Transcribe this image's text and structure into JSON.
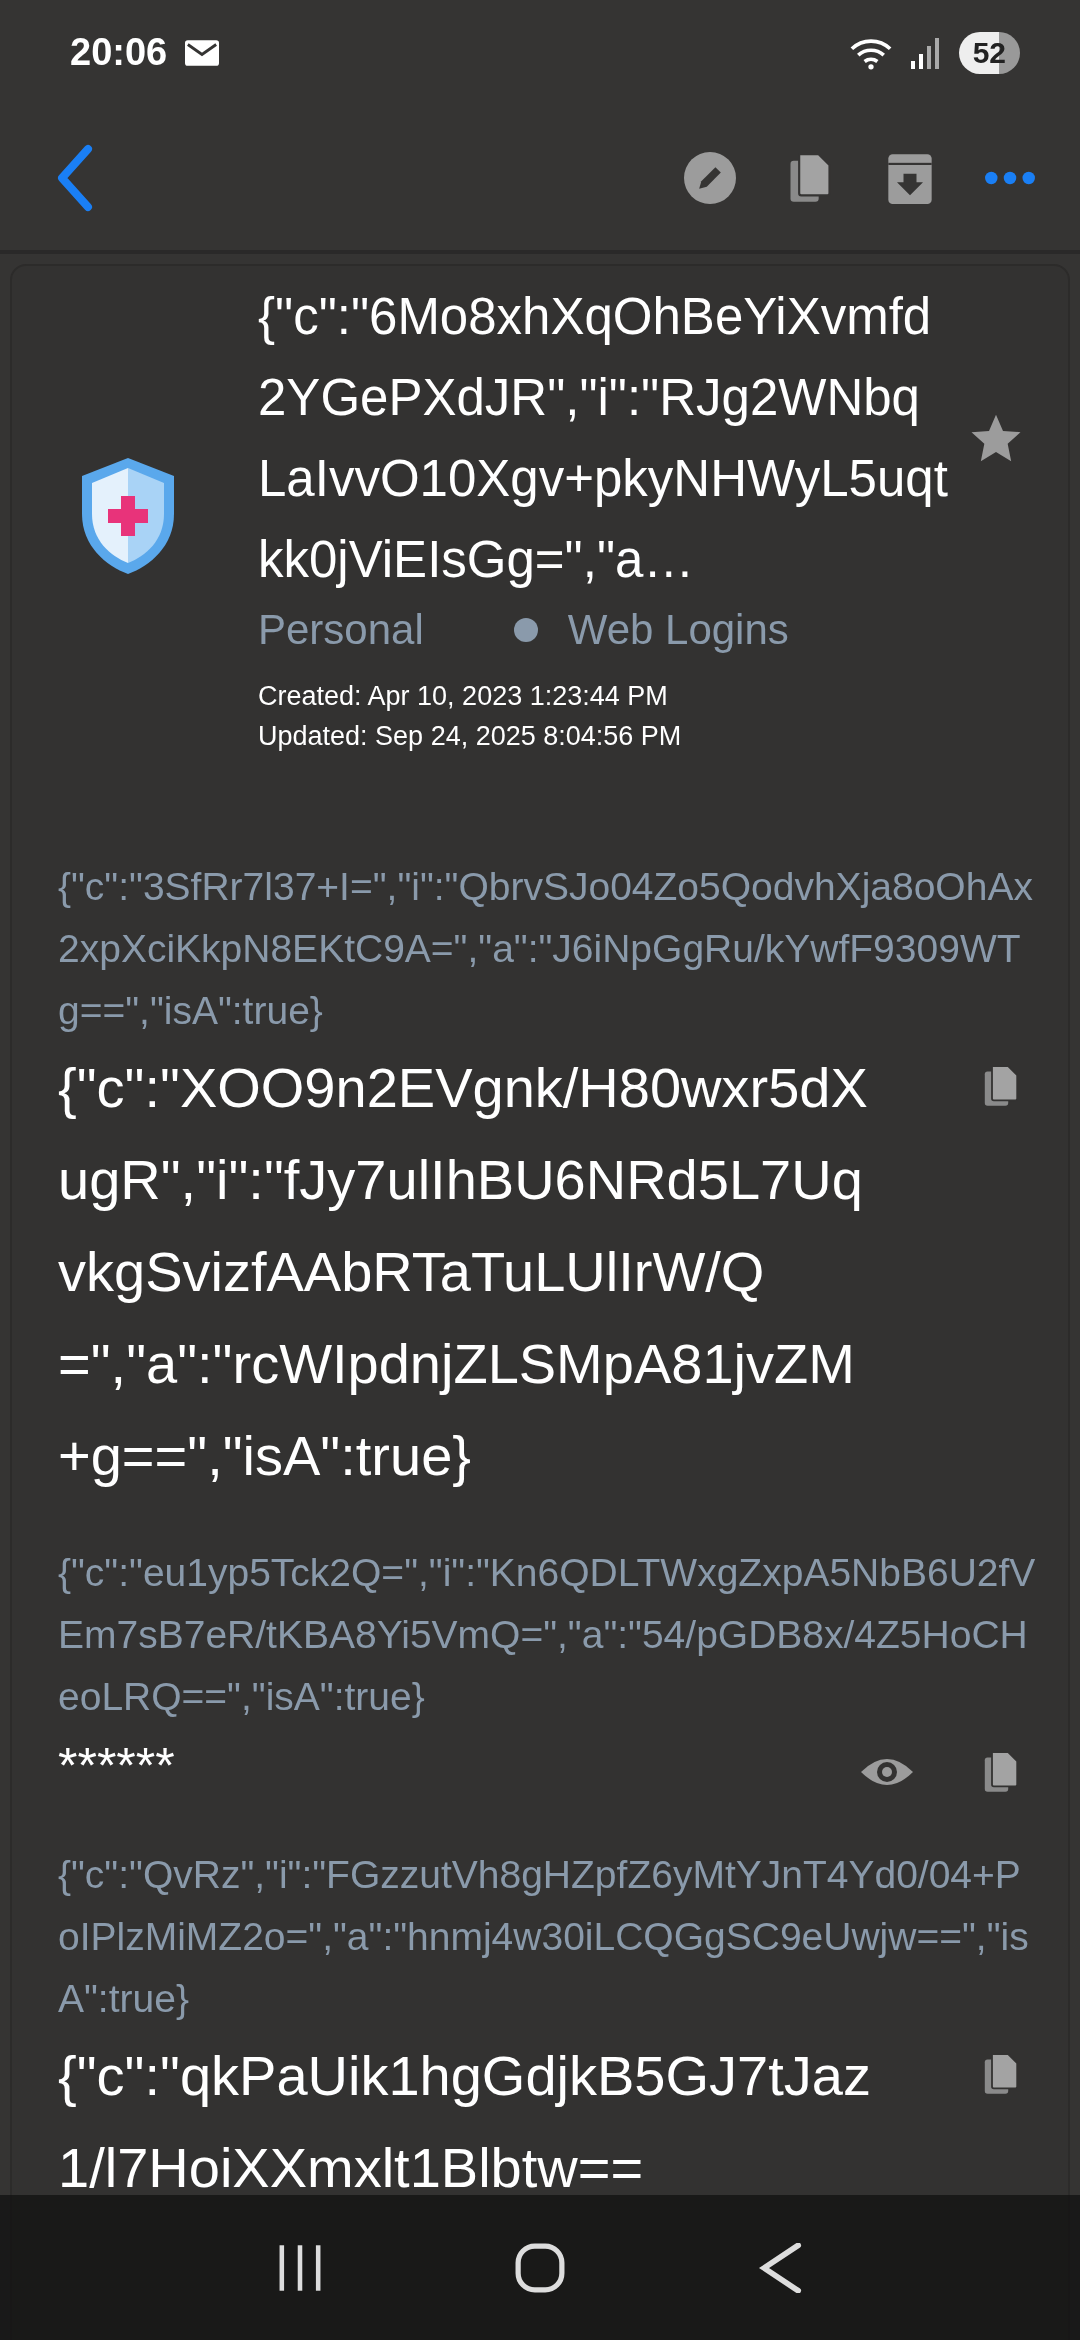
{
  "status_bar": {
    "time": "20:06",
    "battery": "52"
  },
  "item": {
    "title": "{\"c\":\"6Mo8xhXqOhBeYiXvmfd2YGePXdJR\",\"i\":\"RJg2WNbqLaIvvO10Xgv+pkyNHWyL5uqtkk0jViEIsGg=\",\"a…",
    "favorite": false,
    "vault": "Personal",
    "folder": "Web Logins",
    "created": "Created:  Apr 10, 2023 1:23:44 PM",
    "updated": "Updated: Sep 24, 2025 8:04:56 PM"
  },
  "fields": [
    {
      "kind": "text",
      "label": "{\"c\":\"3SfRr7l37+I=\",\"i\":\"QbrvSJo04Zo5QodvhXja8oOhAx2xpXciKkpN8EKtC9A=\",\"a\":\"J6iNpGgRu/kYwfF9309WTg==\",\"isA\":true}",
      "value": "{\"c\":\"XOO9n2EVgnk/H80wxr5dXugR\",\"i\":\"fJy7ulIhBU6NRd5L7UqvkgSvizfAAbRTaTuLUlIrW/Q=\",\"a\":\"rcWIpdnjZLSMpA81jvZM+g==\",\"isA\":true}"
    },
    {
      "kind": "password",
      "label": "{\"c\":\"eu1yp5Tck2Q=\",\"i\":\"Kn6QDLTWxgZxpA5NbB6U2fVEm7sB7eR/tKBA8Yi5VmQ=\",\"a\":\"54/pGDB8x/4Z5HoCHeoLRQ==\",\"isA\":true}",
      "value": "******"
    },
    {
      "kind": "text",
      "label": "{\"c\":\"QvRz\",\"i\":\"FGzzutVh8gHZpfZ6yMtYJnT4Yd0/04+PoIPlzMiMZ2o=\",\"a\":\"hnmj4w30iLCQGgSC9eUwjw==\",\"isA\":true}",
      "value": "{\"c\":\"qkPaUik1hgGdjkB5GJ7tJaz1/l7HoiXXmxlt1Blbtw=="
    }
  ]
}
